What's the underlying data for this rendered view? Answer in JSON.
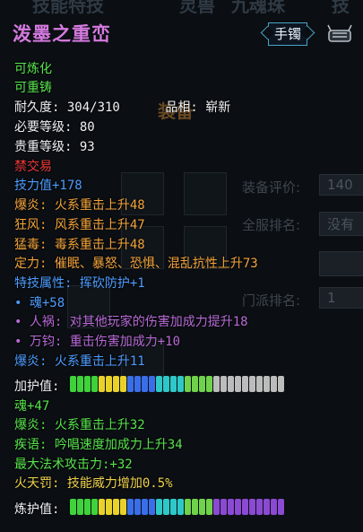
{
  "background": {
    "tabs": [
      "技能特技",
      "灵兽",
      "九魂珠",
      "技"
    ],
    "panel_title": "装备",
    "rows": [
      {
        "label": "装备评价:",
        "value": "140"
      },
      {
        "label": "全服排名:",
        "value": "没有"
      },
      {
        "label": "门派排名:",
        "value": "1"
      }
    ]
  },
  "tooltip": {
    "title": "泼墨之重峦",
    "slot_badge": "手镯",
    "lines": [
      {
        "text": "可炼化",
        "color": "green"
      },
      {
        "text": "可重铸",
        "color": "green"
      },
      {
        "text": "耐久度: 304/310      品相: 崭新",
        "color": "white"
      },
      {
        "text": "必要等级: 80",
        "color": "white"
      },
      {
        "text": "贵重等级: 93",
        "color": "white"
      },
      {
        "text": "禁交易",
        "color": "red"
      },
      {
        "text": "技力值+178",
        "color": "blue"
      },
      {
        "text": "爆炎: 火系重击上升48",
        "color": "orange"
      },
      {
        "text": "狂风: 风系重击上升47",
        "color": "orange"
      },
      {
        "text": "猛毒: 毒系重击上升48",
        "color": "orange"
      },
      {
        "text": "定力: 催眠、暴怒、恐惧、混乱抗性上升73",
        "color": "orange"
      },
      {
        "text": "特技属性: 挥砍防护+1",
        "color": "blue"
      },
      {
        "text": "• 魂+58",
        "color": "blue"
      },
      {
        "text": "• 人祸: 对其他玩家的伤害加成力提升18",
        "color": "purple"
      },
      {
        "text": "• 万钧: 重击伤害加成力+10",
        "color": "purple"
      },
      {
        "text": "爆炎: 火系重击上升11",
        "color": "blue"
      }
    ],
    "protect_label": "加护值:",
    "lines2": [
      {
        "text": "魂+47",
        "color": "green"
      },
      {
        "text": "爆炎: 火系重击上升32",
        "color": "green"
      },
      {
        "text": "疾语: 吟唱速度加成力上升34",
        "color": "green"
      },
      {
        "text": "最大法术攻击力:+32",
        "color": "green"
      },
      {
        "text": "火天罚: 技能威力增加0.5%",
        "color": "yellow"
      }
    ],
    "refine_label": "炼护值:",
    "protect_bar_colors": [
      "#3fd23a",
      "#3fd23a",
      "#3fd23a",
      "#3fd23a",
      "#e8d22a",
      "#e8d22a",
      "#e8d22a",
      "#e8d22a",
      "#3a6ee8",
      "#3a6ee8",
      "#3a6ee8",
      "#3a6ee8",
      "#2ec8c8",
      "#2ec8c8",
      "#2ec8c8",
      "#2ec8c8",
      "#6fd24a",
      "#6fd24a",
      "#6fd24a",
      "#6fd24a",
      "#bcbcbc",
      "#bcbcbc",
      "#bcbcbc",
      "#bcbcbc",
      "#bcbcbc",
      "#bcbcbc",
      "#bcbcbc",
      "#bcbcbc",
      "#bcbcbc",
      "#bcbcbc"
    ],
    "refine_bar_colors": [
      "#3fd23a",
      "#3fd23a",
      "#3fd23a",
      "#3fd23a",
      "#e8d22a",
      "#e8d22a",
      "#e8d22a",
      "#e8d22a",
      "#3a6ee8",
      "#3a6ee8",
      "#3a6ee8",
      "#3a6ee8",
      "#2ec8c8",
      "#2ec8c8",
      "#2ec8c8",
      "#2ec8c8",
      "#6fd24a",
      "#6fd24a",
      "#6fd24a",
      "#6fd24a",
      "#8b4ad2",
      "#8b4ad2",
      "#8b4ad2",
      "#8b4ad2",
      "#8b4ad2",
      "#8b4ad2",
      "#8b4ad2",
      "#8b4ad2",
      "#8b4ad2",
      "#8b4ad2"
    ]
  }
}
